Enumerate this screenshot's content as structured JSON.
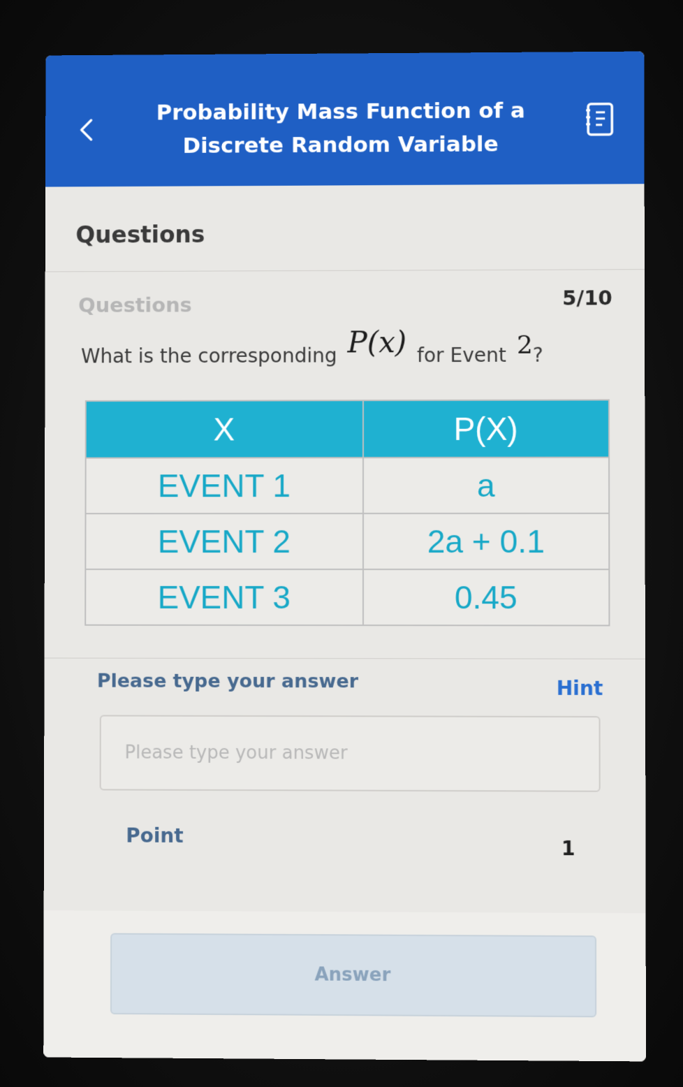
{
  "header": {
    "title": "Probability Mass Function of a Discrete Random Variable"
  },
  "section": {
    "title": "Questions"
  },
  "question_block": {
    "label": "Questions",
    "progress": "5/10",
    "text_before": "What is the corresponding",
    "math_expr": "P(x)",
    "text_middle": "for Event",
    "math_number": "2",
    "text_after": "?"
  },
  "table": {
    "headers": [
      "X",
      "P(X)"
    ],
    "rows": [
      [
        "EVENT 1",
        "a"
      ],
      [
        "EVENT 2",
        "2a + 0.1"
      ],
      [
        "EVENT 3",
        "0.45"
      ]
    ]
  },
  "answer": {
    "label": "Please type your answer",
    "hint": "Hint",
    "placeholder": "Please type your answer",
    "value": ""
  },
  "points": {
    "label": "Point",
    "value": "1"
  },
  "submit": {
    "label": "Answer"
  },
  "colors": {
    "header_blue": "#1f5fc4",
    "table_header": "#1fb1d1",
    "table_text": "#17a8c7",
    "hint_blue": "#2a6fd1"
  },
  "icons": {
    "back": "chevron-left-icon",
    "menu": "notebook-icon"
  }
}
